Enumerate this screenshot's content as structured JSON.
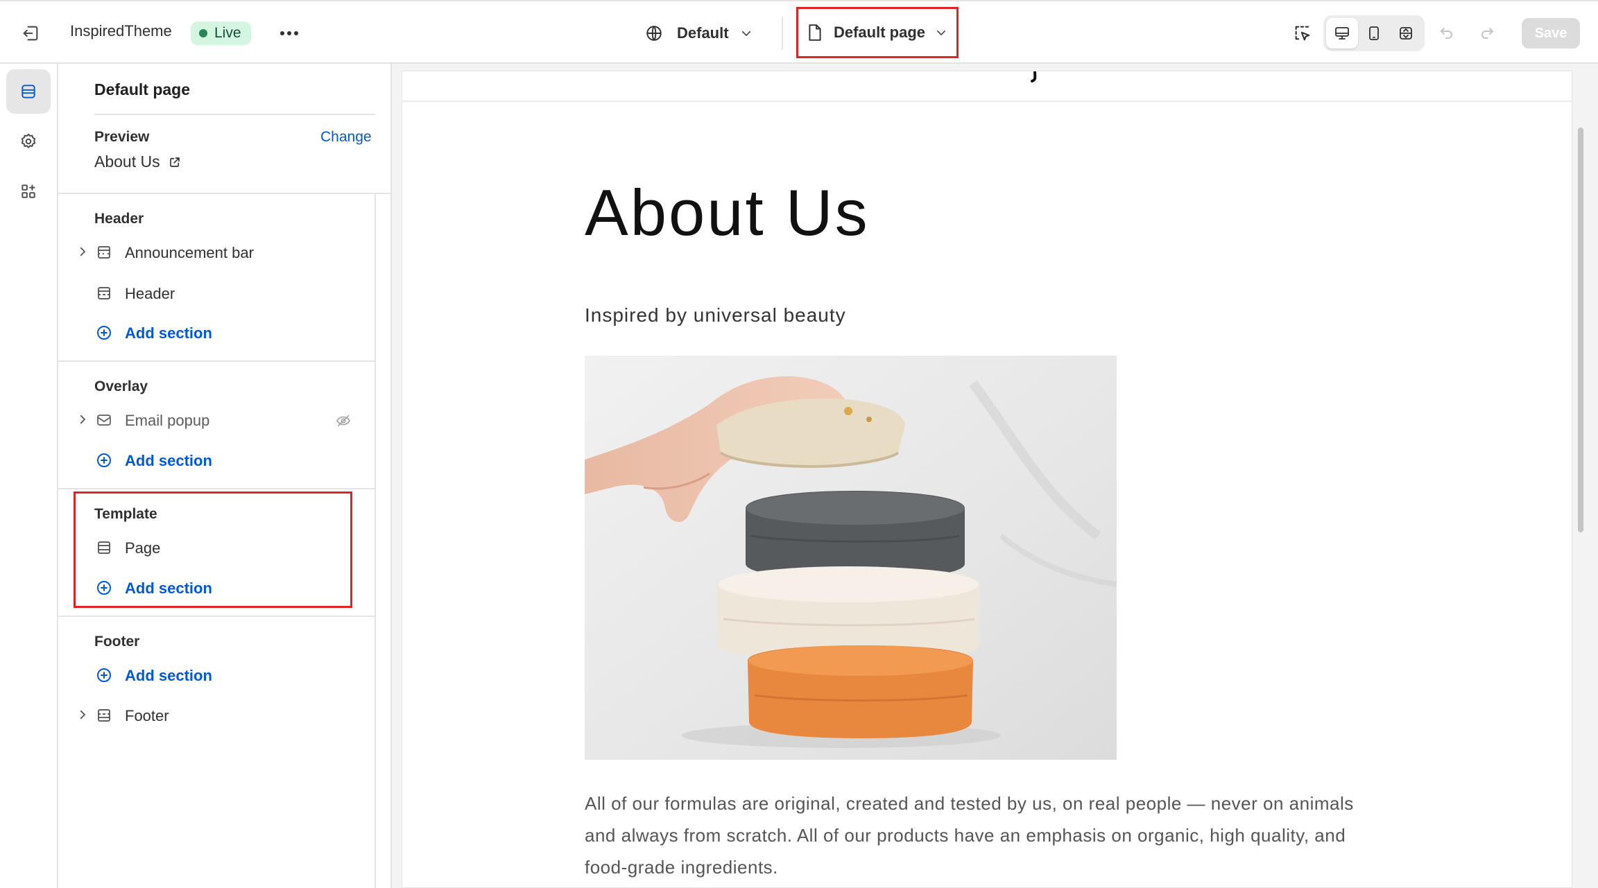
{
  "topbar": {
    "theme_name": "InspiredTheme",
    "status": "Live",
    "language": "Default",
    "page_selector": "Default page",
    "save_label": "Save"
  },
  "sidebar": {
    "title": "Default page",
    "preview_label": "Preview",
    "preview_value": "About Us",
    "change_label": "Change",
    "groups": [
      {
        "title": "Header",
        "items": [
          {
            "label": "Announcement bar",
            "icon": "section-icon"
          },
          {
            "label": "Header",
            "icon": "section-icon"
          },
          {
            "label": "Add section",
            "icon": "plus-circle-icon"
          }
        ]
      },
      {
        "title": "Overlay",
        "items": [
          {
            "label": "Email popup",
            "icon": "envelope-icon"
          },
          {
            "label": "Add section",
            "icon": "plus-circle-icon"
          }
        ]
      },
      {
        "title": "Template",
        "items": [
          {
            "label": "Page",
            "icon": "section-icon"
          },
          {
            "label": "Add section",
            "icon": "plus-circle-icon"
          }
        ]
      },
      {
        "title": "Footer",
        "items": [
          {
            "label": "Add section",
            "icon": "plus-circle-icon"
          },
          {
            "label": "Footer",
            "icon": "section-icon"
          }
        ]
      }
    ]
  },
  "preview": {
    "heading": "About Us",
    "subheading": "Inspired by universal beauty",
    "body": "All of our formulas are original, created and tested by us, on real people — never on animals and always from scratch. All of our products have an emphasis on organic, high quality, and food-grade ingredients."
  },
  "colors": {
    "accent_blue": "#005bd3",
    "highlight_red": "#e02424",
    "live_badge_bg": "#d4f5df",
    "live_badge_text": "#0c5132"
  }
}
